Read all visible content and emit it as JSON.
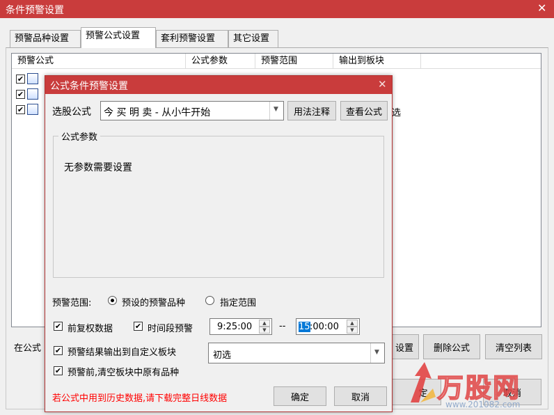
{
  "main_window": {
    "title": "条件预警设置",
    "tabs": [
      "预警品种设置",
      "预警公式设置",
      "套利预警设置",
      "其它设置"
    ],
    "table_headers": [
      "预警公式",
      "公式参数",
      "预警范围",
      "输出到板块"
    ],
    "partial_cell_text": "选",
    "bottom_label_partial": "在公式",
    "buttons": {
      "settings_partial": "设置",
      "delete_formula": "删除公式",
      "clear_list": "清空列表",
      "ok_partial": "定",
      "cancel_partial": "取消"
    }
  },
  "dialog": {
    "title": "公式条件预警设置",
    "formula_label": "选股公式",
    "formula_value": "今 买 明 卖  - 从小牛开始",
    "usage_button": "用法注释",
    "view_button": "查看公式",
    "params_group_label": "公式参数",
    "params_message": "无参数需要设置",
    "range_label": "预警范围:",
    "range_option_preset": "预设的预警品种",
    "range_option_custom": "指定范围",
    "pre_adjust_label": "前复权数据",
    "time_period_label": "时间段预警",
    "time_start": "9:25:00",
    "time_separator": "--",
    "time_end_selected": "15",
    "time_end_rest": ":00:00",
    "output_label": "预警结果输出到自定义板块",
    "output_value": "初选",
    "clear_before_label": "预警前,清空板块中原有品种",
    "warning_text": "若公式中用到历史数据,请下载完整日线数据",
    "ok_button": "确定",
    "cancel_button": "取消"
  },
  "watermark": {
    "brand": "万股网",
    "url": "www.201082.com"
  },
  "colors": {
    "titlebar": "#c93c3c",
    "warning_text": "#ff0000",
    "selection": "#0078d7"
  }
}
